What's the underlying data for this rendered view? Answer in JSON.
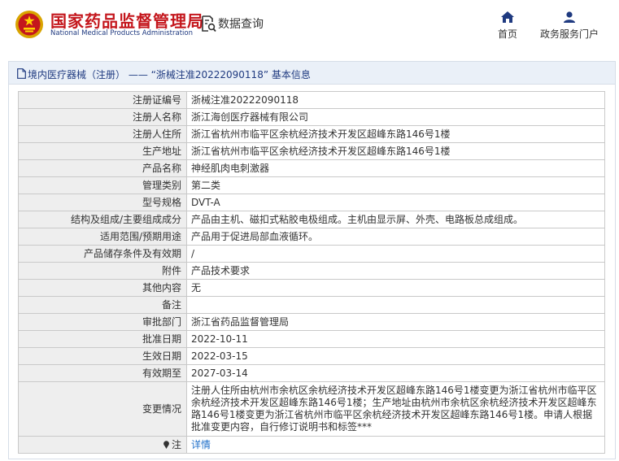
{
  "header": {
    "site_title": "国家药品监督管理局",
    "site_subtitle": "National Medical Products Administration",
    "data_query_label": "数据查询",
    "nav": [
      {
        "label": "首页",
        "icon": "home-icon"
      },
      {
        "label": "政务服务门户",
        "icon": "user-icon"
      }
    ]
  },
  "panel": {
    "title": "境内医疗器械（注册） ——  “浙械注准20222090118” 基本信息"
  },
  "rows": [
    {
      "label": "注册证编号",
      "value": "浙械注准20222090118"
    },
    {
      "label": "注册人名称",
      "value": "浙江海创医疗器械有限公司"
    },
    {
      "label": "注册人住所",
      "value": "浙江省杭州市临平区余杭经济技术开发区超峰东路146号1楼"
    },
    {
      "label": "生产地址",
      "value": "浙江省杭州市临平区余杭经济技术开发区超峰东路146号1楼"
    },
    {
      "label": "产品名称",
      "value": "神经肌肉电刺激器"
    },
    {
      "label": "管理类别",
      "value": "第二类"
    },
    {
      "label": "型号规格",
      "value": "DVT-A"
    },
    {
      "label": "结构及组成/主要组成成分",
      "value": "产品由主机、磁扣式粘胶电极组成。主机由显示屏、外壳、电路板总成组成。"
    },
    {
      "label": "适用范围/预期用途",
      "value": "产品用于促进局部血液循环。"
    },
    {
      "label": "产品储存条件及有效期",
      "value": "/"
    },
    {
      "label": "附件",
      "value": "产品技术要求"
    },
    {
      "label": "其他内容",
      "value": "无"
    },
    {
      "label": "备注",
      "value": ""
    },
    {
      "label": "审批部门",
      "value": "浙江省药品监督管理局"
    },
    {
      "label": "批准日期",
      "value": "2022-10-11"
    },
    {
      "label": "生效日期",
      "value": "2022-03-15"
    },
    {
      "label": "有效期至",
      "value": "2027-03-14"
    },
    {
      "label": "变更情况",
      "value": "注册人住所由杭州市余杭区余杭经济技术开发区超峰东路146号1楼变更为浙江省杭州市临平区余杭经济技术开发区超峰东路146号1楼；生产地址由杭州市余杭区余杭经济技术开发区超峰东路146号1楼变更为浙江省杭州市临平区余杭经济技术开发区超峰东路146号1楼。申请人根据批准变更内容，自行修订说明书和标签***"
    }
  ],
  "note_row": {
    "label": "注",
    "link_text": "详情",
    "icon": "pin-icon"
  }
}
